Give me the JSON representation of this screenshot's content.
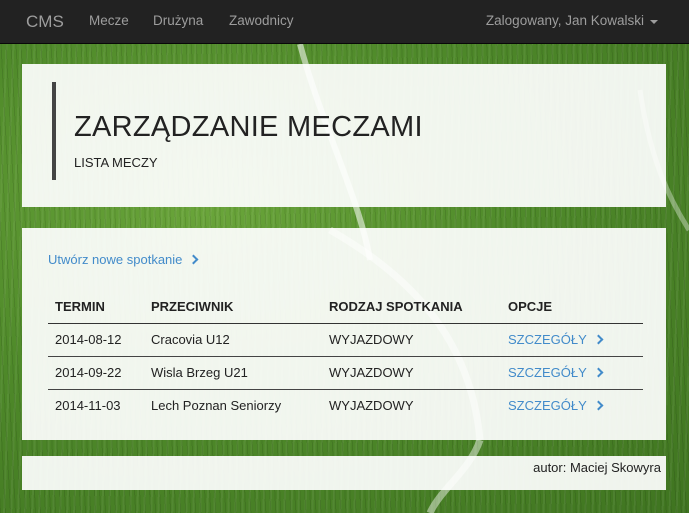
{
  "navbar": {
    "brand": "CMS",
    "links": [
      "Mecze",
      "Drużyna",
      "Zawodnicy"
    ],
    "user": "Zalogowany, Jan Kowalski"
  },
  "header": {
    "title": "ZARZĄDZANIE MECZAMI",
    "subtitle": "LISTA MECZY"
  },
  "actions": {
    "create_label": "Utwórz nowe spotkanie"
  },
  "table": {
    "columns": [
      "TERMIN",
      "PRZECIWNIK",
      "RODZAJ SPOTKANIA",
      "OPCJE"
    ],
    "rows": [
      {
        "date": "2014-08-12",
        "opponent": "Cracovia U12",
        "type": "WYJAZDOWY",
        "option": "SZCZEGÓŁY"
      },
      {
        "date": "2014-09-22",
        "opponent": "Wisla Brzeg U21",
        "type": "WYJAZDOWY",
        "option": "SZCZEGÓŁY"
      },
      {
        "date": "2014-11-03",
        "opponent": "Lech Poznan Seniorzy",
        "type": "WYJAZDOWY",
        "option": "SZCZEGÓŁY"
      }
    ]
  },
  "footer": {
    "author": "autor: Maciej Skowyra"
  },
  "colors": {
    "navbar": "#222222",
    "link": "#428bca",
    "grass": "#4f8a2a"
  }
}
